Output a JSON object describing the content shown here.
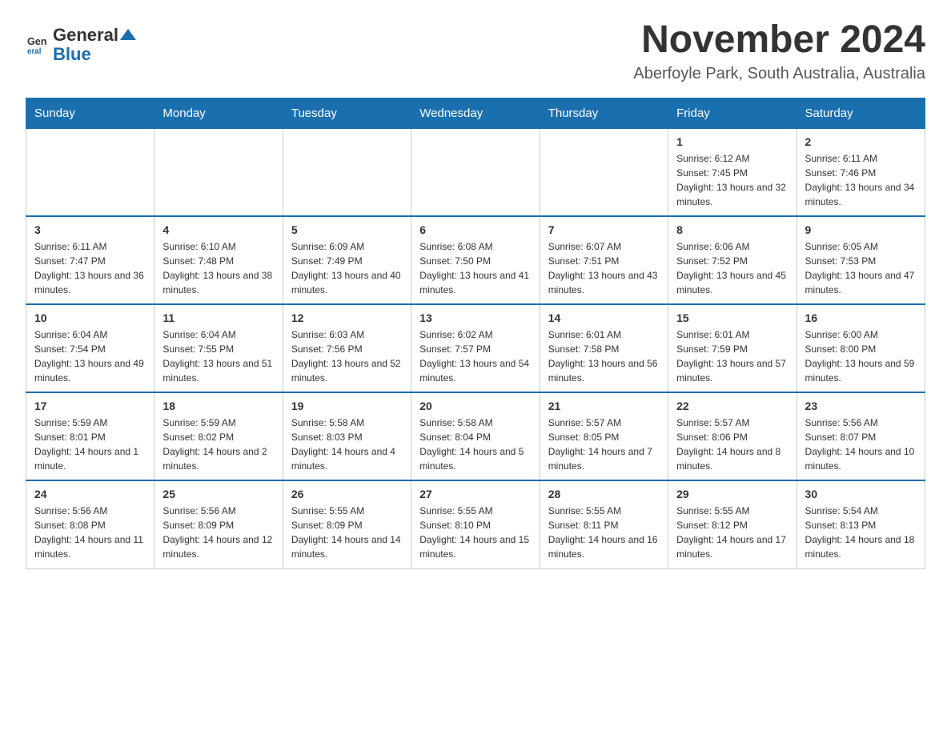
{
  "header": {
    "logo_general": "General",
    "logo_blue": "Blue",
    "month_title": "November 2024",
    "location": "Aberfoyle Park, South Australia, Australia"
  },
  "days_of_week": [
    "Sunday",
    "Monday",
    "Tuesday",
    "Wednesday",
    "Thursday",
    "Friday",
    "Saturday"
  ],
  "weeks": [
    [
      {
        "day": "",
        "info": ""
      },
      {
        "day": "",
        "info": ""
      },
      {
        "day": "",
        "info": ""
      },
      {
        "day": "",
        "info": ""
      },
      {
        "day": "",
        "info": ""
      },
      {
        "day": "1",
        "info": "Sunrise: 6:12 AM\nSunset: 7:45 PM\nDaylight: 13 hours and 32 minutes."
      },
      {
        "day": "2",
        "info": "Sunrise: 6:11 AM\nSunset: 7:46 PM\nDaylight: 13 hours and 34 minutes."
      }
    ],
    [
      {
        "day": "3",
        "info": "Sunrise: 6:11 AM\nSunset: 7:47 PM\nDaylight: 13 hours and 36 minutes."
      },
      {
        "day": "4",
        "info": "Sunrise: 6:10 AM\nSunset: 7:48 PM\nDaylight: 13 hours and 38 minutes."
      },
      {
        "day": "5",
        "info": "Sunrise: 6:09 AM\nSunset: 7:49 PM\nDaylight: 13 hours and 40 minutes."
      },
      {
        "day": "6",
        "info": "Sunrise: 6:08 AM\nSunset: 7:50 PM\nDaylight: 13 hours and 41 minutes."
      },
      {
        "day": "7",
        "info": "Sunrise: 6:07 AM\nSunset: 7:51 PM\nDaylight: 13 hours and 43 minutes."
      },
      {
        "day": "8",
        "info": "Sunrise: 6:06 AM\nSunset: 7:52 PM\nDaylight: 13 hours and 45 minutes."
      },
      {
        "day": "9",
        "info": "Sunrise: 6:05 AM\nSunset: 7:53 PM\nDaylight: 13 hours and 47 minutes."
      }
    ],
    [
      {
        "day": "10",
        "info": "Sunrise: 6:04 AM\nSunset: 7:54 PM\nDaylight: 13 hours and 49 minutes."
      },
      {
        "day": "11",
        "info": "Sunrise: 6:04 AM\nSunset: 7:55 PM\nDaylight: 13 hours and 51 minutes."
      },
      {
        "day": "12",
        "info": "Sunrise: 6:03 AM\nSunset: 7:56 PM\nDaylight: 13 hours and 52 minutes."
      },
      {
        "day": "13",
        "info": "Sunrise: 6:02 AM\nSunset: 7:57 PM\nDaylight: 13 hours and 54 minutes."
      },
      {
        "day": "14",
        "info": "Sunrise: 6:01 AM\nSunset: 7:58 PM\nDaylight: 13 hours and 56 minutes."
      },
      {
        "day": "15",
        "info": "Sunrise: 6:01 AM\nSunset: 7:59 PM\nDaylight: 13 hours and 57 minutes."
      },
      {
        "day": "16",
        "info": "Sunrise: 6:00 AM\nSunset: 8:00 PM\nDaylight: 13 hours and 59 minutes."
      }
    ],
    [
      {
        "day": "17",
        "info": "Sunrise: 5:59 AM\nSunset: 8:01 PM\nDaylight: 14 hours and 1 minute."
      },
      {
        "day": "18",
        "info": "Sunrise: 5:59 AM\nSunset: 8:02 PM\nDaylight: 14 hours and 2 minutes."
      },
      {
        "day": "19",
        "info": "Sunrise: 5:58 AM\nSunset: 8:03 PM\nDaylight: 14 hours and 4 minutes."
      },
      {
        "day": "20",
        "info": "Sunrise: 5:58 AM\nSunset: 8:04 PM\nDaylight: 14 hours and 5 minutes."
      },
      {
        "day": "21",
        "info": "Sunrise: 5:57 AM\nSunset: 8:05 PM\nDaylight: 14 hours and 7 minutes."
      },
      {
        "day": "22",
        "info": "Sunrise: 5:57 AM\nSunset: 8:06 PM\nDaylight: 14 hours and 8 minutes."
      },
      {
        "day": "23",
        "info": "Sunrise: 5:56 AM\nSunset: 8:07 PM\nDaylight: 14 hours and 10 minutes."
      }
    ],
    [
      {
        "day": "24",
        "info": "Sunrise: 5:56 AM\nSunset: 8:08 PM\nDaylight: 14 hours and 11 minutes."
      },
      {
        "day": "25",
        "info": "Sunrise: 5:56 AM\nSunset: 8:09 PM\nDaylight: 14 hours and 12 minutes."
      },
      {
        "day": "26",
        "info": "Sunrise: 5:55 AM\nSunset: 8:09 PM\nDaylight: 14 hours and 14 minutes."
      },
      {
        "day": "27",
        "info": "Sunrise: 5:55 AM\nSunset: 8:10 PM\nDaylight: 14 hours and 15 minutes."
      },
      {
        "day": "28",
        "info": "Sunrise: 5:55 AM\nSunset: 8:11 PM\nDaylight: 14 hours and 16 minutes."
      },
      {
        "day": "29",
        "info": "Sunrise: 5:55 AM\nSunset: 8:12 PM\nDaylight: 14 hours and 17 minutes."
      },
      {
        "day": "30",
        "info": "Sunrise: 5:54 AM\nSunset: 8:13 PM\nDaylight: 14 hours and 18 minutes."
      }
    ]
  ]
}
